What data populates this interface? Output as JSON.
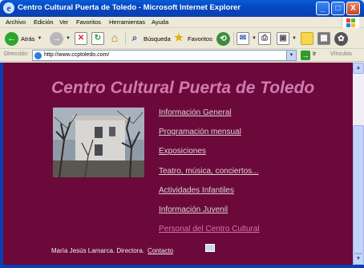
{
  "window": {
    "title": "Centro Cultural Puerta de Toledo - Microsoft Internet Explorer",
    "min_glyph": "_",
    "max_glyph": "□",
    "close_glyph": "X"
  },
  "menu": {
    "items": [
      "Archivo",
      "Edición",
      "Ver",
      "Favoritos",
      "Herramientas",
      "Ayuda"
    ]
  },
  "toolbar": {
    "back_label": "Atrás",
    "search_label": "Búsqueda",
    "favorites_label": "Favoritos"
  },
  "address": {
    "label": "Dirección",
    "url": "http://www.ccptoledo.com/",
    "go_label": "Ir",
    "links_label": "Vínculos"
  },
  "page": {
    "title": "Centro Cultural Puerta de Toledo",
    "nav": [
      {
        "label": "Información General",
        "active": false
      },
      {
        "label": "Programación mensual",
        "active": false
      },
      {
        "label": "Exposiciones",
        "active": false
      },
      {
        "label": "Teatro, música, conciertos...",
        "active": false
      },
      {
        "label": "Actividades Infantiles",
        "active": false
      },
      {
        "label": "Información Juvenil",
        "active": false
      },
      {
        "label": "Personal del Centro Cultural",
        "active": true
      }
    ],
    "footer_text": "María Jesús Lamarca. Directora.",
    "footer_link": "Contacto"
  },
  "colors": {
    "page_background": "#6b0a3a",
    "title_color": "#d07ab2",
    "link_color": "#ddd1d8",
    "active_link_color": "#e06bb4"
  },
  "icons": {
    "back": "back-arrow-icon",
    "forward": "forward-arrow-icon",
    "stop": "stop-icon",
    "refresh": "refresh-icon",
    "home": "home-icon",
    "search": "search-icon",
    "favorites": "star-icon",
    "history": "history-icon",
    "mail": "mail-icon",
    "print": "print-icon"
  }
}
